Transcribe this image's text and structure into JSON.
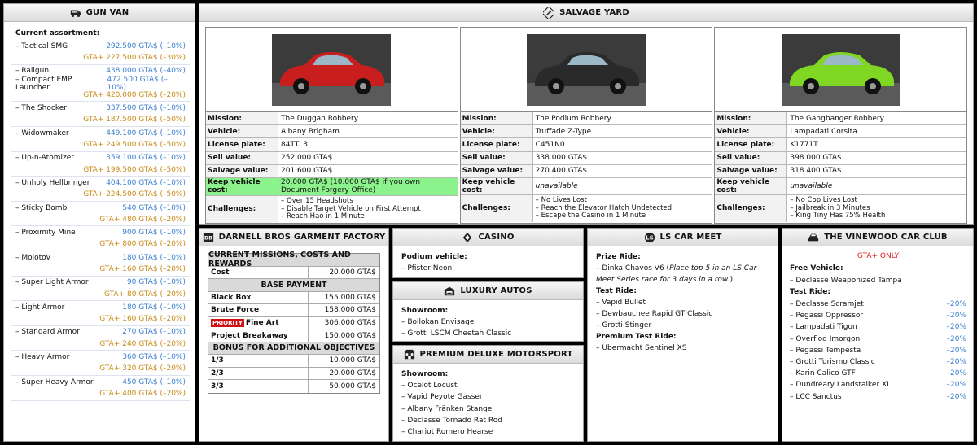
{
  "gun_van": {
    "title": "GUN VAN",
    "heading": "Current assortment:",
    "items": [
      {
        "name": "– Tactical SMG",
        "price": "292.500 GTA$ (–10%)",
        "gta_plus": "GTA+ 227.500 GTA$ (–30%)"
      },
      {
        "name": "– Railgun",
        "price": "438.000 GTA$ (–40%)",
        "gta_plus": ""
      },
      {
        "name": "– Compact EMP Launcher",
        "price": "472.500 GTA$ (–10%)",
        "gta_plus": "GTA+ 420.000 GTA$ (–20%)"
      },
      {
        "name": "– The Shocker",
        "price": "337.500 GTA$ (–10%)",
        "gta_plus": "GTA+ 187.500 GTA$ (–50%)"
      },
      {
        "name": "– Widowmaker",
        "price": "449.100 GTA$ (–10%)",
        "gta_plus": "GTA+ 249.500 GTA$ (–50%)"
      },
      {
        "name": "– Up-n-Atomizer",
        "price": "359.100 GTA$ (–10%)",
        "gta_plus": "GTA+ 199.500 GTA$ (–50%)"
      },
      {
        "name": "– Unholy Hellbringer",
        "price": "404.100 GTA$ (–10%)",
        "gta_plus": "GTA+ 224.500 GTA$ (–50%)"
      },
      {
        "name": "– Sticky Bomb",
        "price": "540 GTA$ (–10%)",
        "gta_plus": "GTA+ 480 GTA$ (–20%)"
      },
      {
        "name": "– Proximity Mine",
        "price": "900 GTA$ (–10%)",
        "gta_plus": "GTA+ 800 GTA$ (–20%)"
      },
      {
        "name": "– Molotov",
        "price": "180 GTA$ (–10%)",
        "gta_plus": "GTA+ 160 GTA$ (–20%)"
      },
      {
        "name": "– Super Light Armor",
        "price": "90 GTA$ (–10%)",
        "gta_plus": "GTA+ 80 GTA$ (–20%)"
      },
      {
        "name": "– Light Armor",
        "price": "180 GTA$ (–10%)",
        "gta_plus": "GTA+ 160 GTA$ (–20%)"
      },
      {
        "name": "– Standard Armor",
        "price": "270 GTA$ (–10%)",
        "gta_plus": "GTA+ 240 GTA$ (–20%)"
      },
      {
        "name": "– Heavy Armor",
        "price": "360 GTA$ (–10%)",
        "gta_plus": "GTA+ 320 GTA$ (–20%)"
      },
      {
        "name": "– Super Heavy Armor",
        "price": "450 GTA$ (–10%)",
        "gta_plus": "GTA+ 400 GTA$ (–20%)"
      }
    ]
  },
  "salvage_yard": {
    "title": "SALVAGE YARD",
    "labels": {
      "mission": "Mission:",
      "vehicle": "Vehicle:",
      "plate": "License plate:",
      "sell": "Sell value:",
      "salvage": "Salvage value:",
      "keep": "Keep vehicle cost:",
      "challenges": "Challenges:"
    },
    "cars": [
      {
        "mission": "The Duggan Robbery",
        "vehicle": "Albany Brigham",
        "plate": "84TTL3",
        "sell": "252.000 GTA$",
        "salvage": "201.600 GTA$",
        "keep": "20.000 GTA$ (10.000 GTA$ if you own Document Forgery Office)",
        "challenges": [
          "– Over 15 Headshots",
          "– Disable Target Vehicle on First Attempt",
          "– Reach Hao in 1 Minute"
        ],
        "color": "#c81e1e"
      },
      {
        "mission": "The Podium Robbery",
        "vehicle": "Truffade Z-Type",
        "plate": "C451N0",
        "sell": "338.000 GTA$",
        "salvage": "270.400 GTA$",
        "keep": "unavailable",
        "challenges": [
          "– No Lives Lost",
          "– Reach the Elevator Hatch Undetected",
          "– Escape the Casino in 1 Minute"
        ],
        "color": "#2a2a2a"
      },
      {
        "mission": "The Gangbanger Robbery",
        "vehicle": "Lampadati Corsita",
        "plate": "K1771T",
        "sell": "398.000 GTA$",
        "salvage": "318.400 GTA$",
        "keep": "unavailable",
        "challenges": [
          "– No Cop Lives Lost",
          "– Jailbreak in 3 Minutes",
          "– King Tiny Has 75% Health"
        ],
        "color": "#7fd623"
      }
    ]
  },
  "darnell": {
    "title": "DARNELL BROS GARMENT FACTORY",
    "h1": "CURRENT MISSIONS, COSTS AND REWARDS",
    "cost_label": "Cost",
    "cost_value": "20.000 GTA$",
    "h2": "BASE PAYMENT",
    "payments": [
      {
        "label": "Black Box",
        "value": "155.000 GTA$"
      },
      {
        "label": "Brute Force",
        "value": "158.000 GTA$"
      },
      {
        "label": "Fine Art",
        "value": "306.000 GTA$"
      },
      {
        "label": "Project Breakaway",
        "value": "150.000 GTA$"
      }
    ],
    "priority": "PRIORITY",
    "h3": "BONUS FOR ADDITIONAL OBJECTIVES",
    "bonus": [
      {
        "label": "1/3",
        "value": "10.000 GTA$"
      },
      {
        "label": "2/3",
        "value": "20.000 GTA$"
      },
      {
        "label": "3/3",
        "value": "50.000 GTA$"
      }
    ]
  },
  "casino": {
    "title": "CASINO",
    "label": "Podium vehicle:",
    "item": "– Pfister Neon"
  },
  "luxury": {
    "title": "LUXURY AUTOS",
    "label": "Showroom:",
    "items": [
      "– Bollokan Envisage",
      "– Grotti LSCM Cheetah Classic"
    ]
  },
  "pdm": {
    "title": "PREMIUM DELUXE MOTORSPORT",
    "label": "Showroom:",
    "items": [
      "– Ocelot Locust",
      "– Vapid Peyote Gasser",
      "– Albany Fränken Stange",
      "– Declasse Tornado Rat Rod",
      "– Chariot Romero Hearse"
    ]
  },
  "car_meet": {
    "title": "LS CAR MEET",
    "prize_label": "Prize Ride:",
    "prize_name": "– Dinka Chavos V6 (",
    "prize_note": "Place top 5 in an LS Car Meet Series race for 3 days in a row.",
    "prize_close": ")",
    "test_label": "Test Ride:",
    "test_items": [
      "– Vapid Bullet",
      "– Dewbauchee Rapid GT Classic",
      "– Grotti Stinger"
    ],
    "premium_label": "Premium Test Ride:",
    "premium_item": "– Ubermacht Sentinel XS"
  },
  "vinewood": {
    "title": "THE VINEWOOD CAR CLUB",
    "gta_only": "GTA+ ONLY",
    "free_label": "Free Vehicle:",
    "free_item": "– Declasse Weaponized Tampa",
    "test_label": "Test Ride:",
    "items": [
      {
        "name": "– Declasse Scramjet",
        "discount": "–20%"
      },
      {
        "name": "– Pegassi Oppressor",
        "discount": "–20%"
      },
      {
        "name": "– Lampadati Tigon",
        "discount": "–20%"
      },
      {
        "name": "– Overflod Imorgon",
        "discount": "–20%"
      },
      {
        "name": "– Pegassi Tempesta",
        "discount": "–20%"
      },
      {
        "name": "– Grotti Turismo Classic",
        "discount": "–20%"
      },
      {
        "name": "– Karin Calico GTF",
        "discount": "–20%"
      },
      {
        "name": "– Dundreary Landstalker XL",
        "discount": "–20%"
      },
      {
        "name": "– LCC Sanctus",
        "discount": "–20%"
      }
    ]
  }
}
